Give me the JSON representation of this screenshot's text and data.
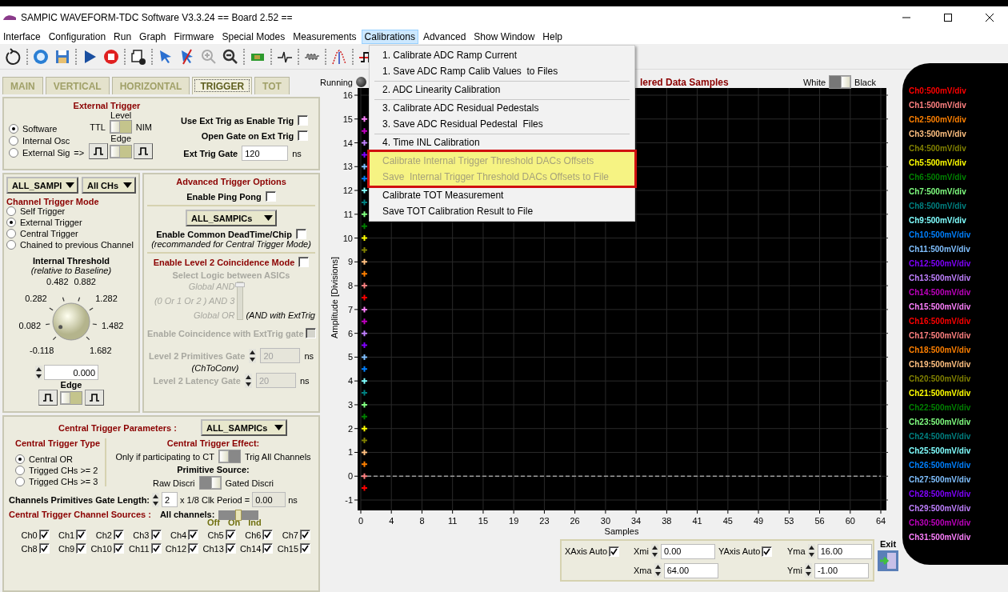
{
  "window": {
    "title": "SAMPIC WAVEFORM-TDC Software V3.3.24 == Board 2.52 =="
  },
  "menu_bar": [
    {
      "label": "Interface",
      "selected": false
    },
    {
      "label": "Configuration",
      "selected": false
    },
    {
      "label": "Run",
      "selected": false
    },
    {
      "label": "Graph",
      "selected": false
    },
    {
      "label": "Firmware",
      "selected": false
    },
    {
      "label": "Special Modes",
      "selected": false
    },
    {
      "label": "Measurements",
      "selected": false
    },
    {
      "label": "Calibrations",
      "selected": true
    },
    {
      "label": "Advanced",
      "selected": false
    },
    {
      "label": "Show Window",
      "selected": false
    },
    {
      "label": "Help",
      "selected": false
    }
  ],
  "calibrations_menu": [
    {
      "separator": false,
      "highlighted": false,
      "items": [
        {
          "label": "1. Calibrate ADC Ramp Current",
          "disabled": false
        },
        {
          "label": "1. Save ADC Ramp Calib Values  to Files",
          "disabled": false
        }
      ]
    },
    {
      "separator": true,
      "highlighted": false,
      "items": [
        {
          "label": "2. ADC Linearity Calibration",
          "disabled": false
        }
      ]
    },
    {
      "separator": true,
      "highlighted": false,
      "items": [
        {
          "label": "3. Calibrate ADC Residual Pedestals",
          "disabled": false
        },
        {
          "label": "3. Save ADC Residual Pedestal  Files",
          "disabled": false
        }
      ]
    },
    {
      "separator": true,
      "highlighted": false,
      "items": [
        {
          "label": "4. Time INL Calibration",
          "disabled": false
        }
      ]
    },
    {
      "separator": false,
      "highlighted": true,
      "items": [
        {
          "label": "Calibrate Internal Trigger Threshold DACs Offsets",
          "disabled": true
        },
        {
          "label": "Save  Internal Trigger Threshold DACs Offsets to File",
          "disabled": true
        }
      ]
    },
    {
      "separator": false,
      "highlighted": false,
      "items": [
        {
          "label": "Calibrate TOT Measurement",
          "disabled": false
        },
        {
          "label": "Save TOT Calibration Result to File",
          "disabled": false
        }
      ]
    }
  ],
  "tabs": [
    {
      "label": "MAIN",
      "selected": false
    },
    {
      "label": "VERTICAL",
      "selected": false
    },
    {
      "label": "HORIZONTAL",
      "selected": false
    },
    {
      "label": "TRIGGER",
      "selected": true
    },
    {
      "label": "TOT",
      "selected": false
    }
  ],
  "external_trigger": {
    "title": "External Trigger",
    "sources": [
      {
        "label": "Software",
        "selected": true
      },
      {
        "label": "Internal Osc",
        "selected": false
      },
      {
        "label": "External Sig",
        "selected": false
      }
    ],
    "source_arrow": "=>",
    "level_label": "Level",
    "level_switch": {
      "left": "TTL",
      "right": "NIM",
      "on": false
    },
    "edge_label": "Edge",
    "edge_switch": {
      "on": false
    },
    "options": [
      {
        "label": "Use Ext Trig as Enable Trig",
        "checked": false
      },
      {
        "label": "Open Gate on Ext Trig",
        "checked": false
      }
    ],
    "gate": {
      "label": "Ext Trig Gate",
      "value": "120",
      "unit": "ns"
    }
  },
  "channel_trigger": {
    "sampic_select": "ALL_SAMPI",
    "channel_select": "All CHs",
    "mode_title": "Channel Trigger Mode",
    "modes": [
      {
        "label": "Self Trigger",
        "selected": false
      },
      {
        "label": "External Trigger",
        "selected": true
      },
      {
        "label": "Central Trigger",
        "selected": false
      },
      {
        "label": "Chained to previous Channel",
        "selected": false
      }
    ],
    "threshold": {
      "title": "Internal Threshold",
      "subtitle": "(relative to Baseline)",
      "scale": [
        "-0.118",
        "0.082",
        "0.282",
        "0.482",
        "0.882",
        "1.282",
        "1.482",
        "1.682"
      ],
      "value": "0.000"
    },
    "edge_label": "Edge",
    "edge_switch": {
      "on": false
    }
  },
  "advanced": {
    "title": "Advanced Trigger Options",
    "ping_pong": {
      "label": "Enable Ping Pong",
      "checked": false
    },
    "sampic_select": "ALL_SAMPICs",
    "deadtime": {
      "label": "Enable Common DeadTime/Chip",
      "checked": false
    },
    "deadtime_note": "(recommanded for Central Trigger Mode)",
    "level2": {
      "label": "Enable Level 2 Coincidence Mode",
      "checked": false,
      "disabled": true,
      "logic_title": "Select Logic between ASICs",
      "logic_options": [
        "Global AND",
        "(0 Or 1 Or 2 ) AND 3",
        "Global OR"
      ],
      "logic_note": "(AND with ExtTrig",
      "exttrig": {
        "label": "Enable Coincidence with ExtTrig gate",
        "checked": false
      },
      "primitives_gate": {
        "label": "Level 2 Primitives Gate",
        "value": "20",
        "unit": "ns"
      },
      "primitives_note": "(ChToConv)",
      "latency_gate": {
        "label": "Level 2 Latency Gate",
        "value": "20",
        "unit": "ns"
      }
    }
  },
  "central_trigger": {
    "title": "Central Trigger Parameters :",
    "sampic_select": "ALL_SAMPICs",
    "type_title": "Central Trigger Type",
    "types": [
      {
        "label": "Central OR",
        "selected": true
      },
      {
        "label": "Trigged CHs >= 2",
        "selected": false
      },
      {
        "label": "Trigged CHs >= 3",
        "selected": false
      }
    ],
    "effect_title": "Central Trigger Effect:",
    "effect_switch": {
      "left": "Only if participating to CT",
      "right": "Trig All Channels",
      "on": false
    },
    "primitive_title": "Primitive Source:",
    "primitive_switch": {
      "left": "Raw Discri",
      "right": "Gated Discri",
      "on": true
    },
    "gate_length": {
      "label": "Channels Primitives Gate Length:",
      "value": "2",
      "period_label": "x 1/8 Clk Period =",
      "period_value": "0.00",
      "unit": "ns"
    },
    "sources_title": "Central Trigger Channel Sources :",
    "all_label": "All channels:",
    "all_positions": [
      "Off",
      "On",
      "Ind"
    ],
    "all_slider": {
      "level": 0.5
    },
    "channels": [
      {
        "label": "Ch0",
        "checked": true
      },
      {
        "label": "Ch1",
        "checked": true
      },
      {
        "label": "Ch2",
        "checked": true
      },
      {
        "label": "Ch3",
        "checked": true
      },
      {
        "label": "Ch4",
        "checked": true
      },
      {
        "label": "Ch5",
        "checked": true
      },
      {
        "label": "Ch6",
        "checked": true
      },
      {
        "label": "Ch7",
        "checked": true
      },
      {
        "label": "Ch8",
        "checked": true
      },
      {
        "label": "Ch9",
        "checked": true
      },
      {
        "label": "Ch10",
        "checked": true
      },
      {
        "label": "Ch11",
        "checked": true
      },
      {
        "label": "Ch12",
        "checked": true
      },
      {
        "label": "Ch13",
        "checked": true
      },
      {
        "label": "Ch14",
        "checked": true
      },
      {
        "label": "Ch15",
        "checked": true
      }
    ]
  },
  "graph": {
    "running": {
      "label": "Running",
      "on": false
    },
    "title": "lered Data Samples",
    "background_switch": {
      "left": "White",
      "right": "Black",
      "on": true
    },
    "chart_data": {
      "type": "line",
      "xlabel": "Samples",
      "ylabel": "Amplitude [Divisions]",
      "xlim": [
        0,
        64
      ],
      "ylim": [
        -1,
        16
      ],
      "xticks": [
        {
          "value": 0,
          "label": "0"
        },
        {
          "value": 3.76,
          "label": "4"
        },
        {
          "value": 7.53,
          "label": "8"
        },
        {
          "value": 11.29,
          "label": "11"
        },
        {
          "value": 15.06,
          "label": "15"
        },
        {
          "value": 18.82,
          "label": "19"
        },
        {
          "value": 22.59,
          "label": "23"
        },
        {
          "value": 26.35,
          "label": "26"
        },
        {
          "value": 30.12,
          "label": "30"
        },
        {
          "value": 33.88,
          "label": "34"
        },
        {
          "value": 37.65,
          "label": "38"
        },
        {
          "value": 41.41,
          "label": "41"
        },
        {
          "value": 45.18,
          "label": "45"
        },
        {
          "value": 48.94,
          "label": "49"
        },
        {
          "value": 52.71,
          "label": "53"
        },
        {
          "value": 56.47,
          "label": "56"
        },
        {
          "value": 60.24,
          "label": "60"
        },
        {
          "value": 64,
          "label": "64"
        }
      ],
      "yticks": [
        -1,
        0,
        1,
        2,
        3,
        4,
        5,
        6,
        7,
        8,
        9,
        10,
        11,
        12,
        13,
        14,
        15,
        16
      ],
      "x": [
        0,
        64
      ],
      "grid": true,
      "series": [
        {
          "color": "#9a9a9a",
          "line_style": "dashed",
          "values": [
            0,
            0
          ]
        }
      ]
    },
    "axis_controls": {
      "x_auto": {
        "label": "XAxis Auto",
        "checked": true
      },
      "xmin": {
        "label": "Xmi",
        "value": "0.00"
      },
      "xmax": {
        "label": "Xma",
        "value": "64.00"
      },
      "y_auto": {
        "label": "YAxis Auto",
        "checked": true
      },
      "ymax": {
        "label": "Yma",
        "value": "16.00"
      },
      "ymin": {
        "label": "Ymi",
        "value": "-1.00"
      }
    },
    "exit_label": "Exit"
  },
  "legend": [
    {
      "label": "Ch0:500mV/div",
      "color": "#ff0000"
    },
    {
      "label": "Ch1:500mV/div",
      "color": "#ff8080"
    },
    {
      "label": "Ch2:500mV/div",
      "color": "#ff8000"
    },
    {
      "label": "Ch3:500mV/div",
      "color": "#ffc080"
    },
    {
      "label": "Ch4:500mV/div",
      "color": "#808000"
    },
    {
      "label": "Ch5:500mV/div",
      "color": "#ffff00"
    },
    {
      "label": "Ch6:500mV/div",
      "color": "#008000"
    },
    {
      "label": "Ch7:500mV/div",
      "color": "#80ff80"
    },
    {
      "label": "Ch8:500mV/div",
      "color": "#008080"
    },
    {
      "label": "Ch9:500mV/div",
      "color": "#80ffff"
    },
    {
      "label": "Ch10:500mV/div",
      "color": "#0080ff"
    },
    {
      "label": "Ch11:500mV/div",
      "color": "#80c0ff"
    },
    {
      "label": "Ch12:500mV/div",
      "color": "#8000ff"
    },
    {
      "label": "Ch13:500mV/div",
      "color": "#c080ff"
    },
    {
      "label": "Ch14:500mV/div",
      "color": "#c000c0"
    },
    {
      "label": "Ch15:500mV/div",
      "color": "#ff80ff"
    },
    {
      "label": "Ch16:500mV/div",
      "color": "#ff0000"
    },
    {
      "label": "Ch17:500mV/div",
      "color": "#ff8080"
    },
    {
      "label": "Ch18:500mV/div",
      "color": "#ff8000"
    },
    {
      "label": "Ch19:500mV/div",
      "color": "#ffc080"
    },
    {
      "label": "Ch20:500mV/div",
      "color": "#808000"
    },
    {
      "label": "Ch21:500mV/div",
      "color": "#ffff00"
    },
    {
      "label": "Ch22:500mV/div",
      "color": "#008000"
    },
    {
      "label": "Ch23:500mV/div",
      "color": "#80ff80"
    },
    {
      "label": "Ch24:500mV/div",
      "color": "#008080"
    },
    {
      "label": "Ch25:500mV/div",
      "color": "#80ffff"
    },
    {
      "label": "Ch26:500mV/div",
      "color": "#0080ff"
    },
    {
      "label": "Ch27:500mV/div",
      "color": "#80c0ff"
    },
    {
      "label": "Ch28:500mV/div",
      "color": "#8000ff"
    },
    {
      "label": "Ch29:500mV/div",
      "color": "#c080ff"
    },
    {
      "label": "Ch30:500mV/div",
      "color": "#c000c0"
    },
    {
      "label": "Ch31:500mV/div",
      "color": "#ff80ff"
    }
  ]
}
